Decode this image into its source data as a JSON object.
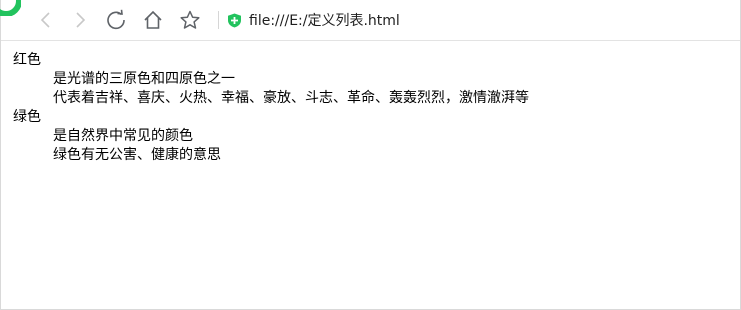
{
  "browser": {
    "address_url": "file:///E:/定义列表.html",
    "icons": {
      "back": "chevron-left-icon",
      "forward": "chevron-right-icon",
      "reload": "reload-icon",
      "home": "home-icon",
      "bookmark": "star-icon",
      "secure": "shield-plus-icon",
      "browser_logo": "browser-logo-icon"
    },
    "colors": {
      "accent_green": "#22c35e",
      "icon_gray": "#5f6368",
      "icon_disabled": "#c8c8c8"
    }
  },
  "page": {
    "definitions": [
      {
        "term": "红色",
        "descriptions": [
          "是光谱的三原色和四原色之一",
          "代表着吉祥、喜庆、火热、幸福、豪放、斗志、革命、轰轰烈烈，激情澈湃等"
        ]
      },
      {
        "term": "绿色",
        "descriptions": [
          "是自然界中常见的颜色",
          "绿色有无公害、健康的意思"
        ]
      }
    ]
  }
}
